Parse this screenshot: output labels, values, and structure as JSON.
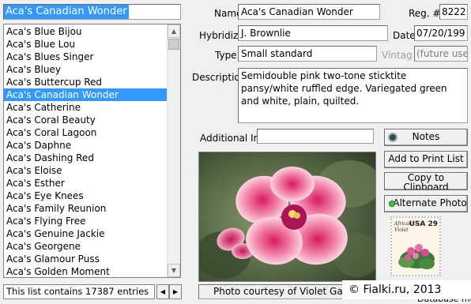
{
  "search": {
    "value": "Aca's Canadian Wonder"
  },
  "list": {
    "items": [
      "Aca's Blue Bijou",
      "Aca's Blue Lou",
      "Aca's Blues Singer",
      "Aca's Bluey",
      "Aca's Buttercup Red",
      "Aca's Canadian Wonder",
      "Aca's Catherine",
      "Aca's Coral Beauty",
      "Aca's Coral Lagoon",
      "Aca's Daphne",
      "Aca's Dashing Red",
      "Aca's Eloise",
      "Aca's Esther",
      "Aca's Eye Knees",
      "Aca's Family Reunion",
      "Aca's Flying Free",
      "Aca's Genuine Jackie",
      "Aca's Georgene",
      "Aca's Glamour Puss",
      "Aca's Golden Moment"
    ],
    "selected_index": 5
  },
  "status": {
    "text": "This list contains 17387 entries"
  },
  "details": {
    "name_label": "Name",
    "name_value": "Aca's Canadian Wonder",
    "reg_label": "Reg. #",
    "reg_value": "8222",
    "hybridizer_label": "Hybridiz",
    "hybridizer_value": "J. Brownlie",
    "date_label": "Date",
    "date_value": "07/20/199",
    "type_label": "Type",
    "type_value": "Small standard",
    "vintage_label": "Vintag",
    "vintage_value": "(future use",
    "description_label": "Descriptio",
    "description_value": "Semidouble pink two-tone sticktite pansy/white ruffled edge. Variegated green and white, plain, quilted.",
    "additional_label": "Additional Ir",
    "additional_value": ""
  },
  "buttons": {
    "notes": "Notes",
    "print_list": "Add to Print List",
    "clipboard": "Copy to Clipboard",
    "alt_photo": "Alternate Photo"
  },
  "photo": {
    "caption": "Photo courtesy of Violet Gal"
  },
  "stamp": {
    "line1": "African",
    "line2": "Violet",
    "denomination": "USA 29"
  },
  "footer": {
    "partial": "Database may",
    "copyright": "© Fialki.ru, 2013"
  },
  "colors": {
    "selection": "#3399ff",
    "notes_led": "#2f4f4f",
    "alt_led": "#2ecc40"
  }
}
